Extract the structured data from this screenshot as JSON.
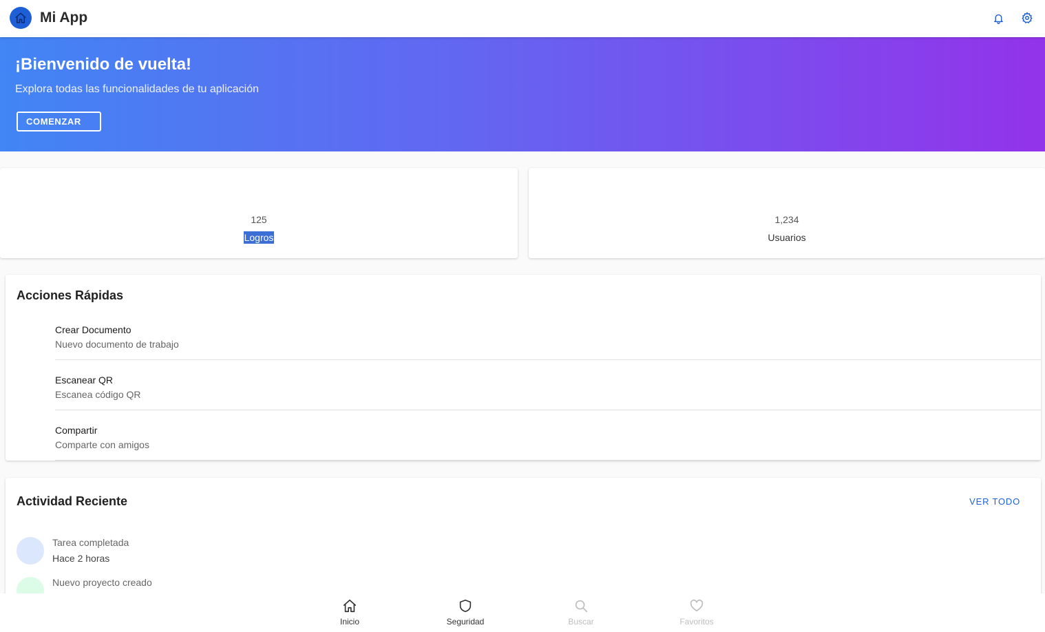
{
  "app": {
    "title": "Mi App",
    "logo_icon": "home-icon"
  },
  "header_actions": [
    {
      "icon": "bell-icon"
    },
    {
      "icon": "gear-icon"
    }
  ],
  "hero": {
    "title": "¡Bienvenido de vuelta!",
    "subtitle": "Explora todas las funcionalidades de tu aplicación",
    "button_label": "COMENZAR"
  },
  "stats": [
    {
      "value": "125",
      "label": "Logros",
      "selected": true
    },
    {
      "value": "1,234",
      "label": "Usuarios",
      "selected": false
    }
  ],
  "quick_actions": {
    "title": "Acciones Rápidas",
    "items": [
      {
        "title": "Crear Documento",
        "subtitle": "Nuevo documento de trabajo"
      },
      {
        "title": "Escanear QR",
        "subtitle": "Escanea código QR"
      },
      {
        "title": "Compartir",
        "subtitle": "Comparte con amigos"
      }
    ]
  },
  "recent_activity": {
    "title": "Actividad Reciente",
    "see_all_label": "VER TODO",
    "items": [
      {
        "title": "Tarea completada",
        "time": "Hace 2 horas",
        "color": "#dbe7fd"
      },
      {
        "title": "Nuevo proyecto creado",
        "time": "",
        "color": "#dcfce7"
      }
    ]
  },
  "bottom_nav": {
    "items": [
      {
        "label": "Inicio",
        "icon": "home-icon",
        "enabled": true
      },
      {
        "label": "Seguridad",
        "icon": "shield-icon",
        "enabled": true
      },
      {
        "label": "Buscar",
        "icon": "search-icon",
        "enabled": false
      },
      {
        "label": "Favoritos",
        "icon": "heart-icon",
        "enabled": false
      }
    ]
  },
  "colors": {
    "primary": "#1e5fd8",
    "hero_gradient_start": "#4285f4",
    "hero_gradient_end": "#9333ea",
    "nav_active": "#333333",
    "nav_disabled": "#bdbdbd"
  }
}
